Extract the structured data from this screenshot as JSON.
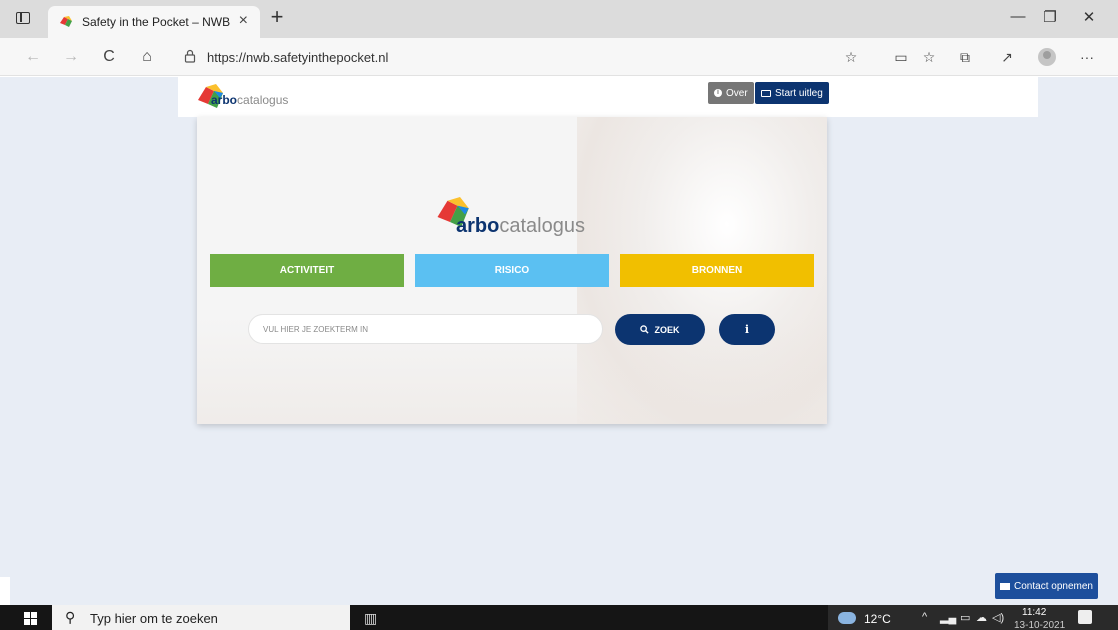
{
  "browser": {
    "tab_title": "Safety in the Pocket – NWB",
    "tab_close": "×",
    "new_tab": "+",
    "url": "https://nwb.safetyinthepocket.nl",
    "back": "←",
    "forward": "→",
    "refresh": "C",
    "home": "⌂",
    "minimize": "—",
    "restore": "❐",
    "close": "✕",
    "more": "···"
  },
  "header": {
    "logo_bold": "arbo",
    "logo_rest": "catalogus",
    "over_label": "Over",
    "start_label": "Start uitleg"
  },
  "main": {
    "logo_bold": "arbo",
    "logo_rest": "catalogus",
    "categories": [
      {
        "label": "ACTIVITEIT",
        "color": "#6fae43"
      },
      {
        "label": "RISICO",
        "color": "#5bc0f2"
      },
      {
        "label": "BRONNEN",
        "color": "#f1bf00"
      }
    ],
    "search_placeholder": "VUL HIER JE ZOEKTERM IN",
    "zoek_label": "ZOEK",
    "info_label": "i"
  },
  "contact_label": "Contact opnemen",
  "taskbar": {
    "search_placeholder": "Typ hier om te zoeken",
    "temperature": "12°C",
    "time": "11:42",
    "date": "13-10-2021"
  },
  "colors": {
    "navy": "#0c3470",
    "page_bg": "#e8edf5",
    "contact_blue": "#1d4f9c"
  }
}
